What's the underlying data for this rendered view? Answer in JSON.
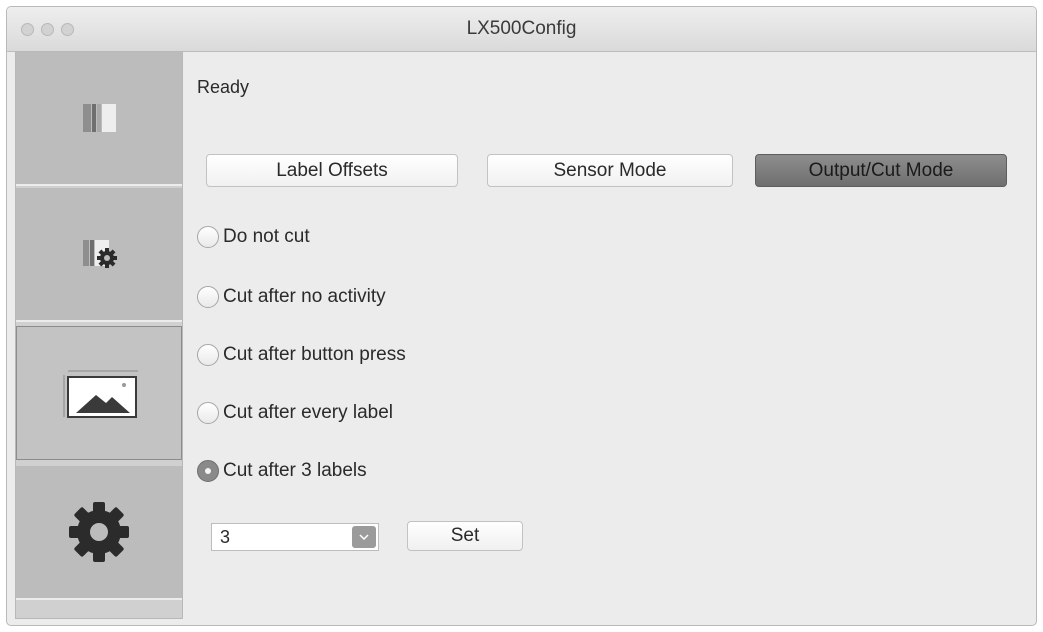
{
  "window": {
    "title": "LX500Config"
  },
  "sidebar": {
    "items": [
      {
        "icon": "label-roll-icon"
      },
      {
        "icon": "label-settings-icon"
      },
      {
        "icon": "image-print-icon",
        "active": true
      },
      {
        "icon": "gear-icon"
      }
    ]
  },
  "status": {
    "text": "Ready"
  },
  "tabs": [
    {
      "label": "Label Offsets",
      "active": false
    },
    {
      "label": "Sensor Mode",
      "active": false
    },
    {
      "label": "Output/Cut Mode",
      "active": true
    }
  ],
  "cut_options": [
    {
      "label": "Do not cut",
      "checked": false
    },
    {
      "label": "Cut after no activity",
      "checked": false
    },
    {
      "label": "Cut after button press",
      "checked": false
    },
    {
      "label": "Cut after every label",
      "checked": false
    },
    {
      "label": "Cut after 3 labels",
      "checked": true
    }
  ],
  "labels_count": {
    "value": "3"
  },
  "set_button": {
    "label": "Set"
  }
}
